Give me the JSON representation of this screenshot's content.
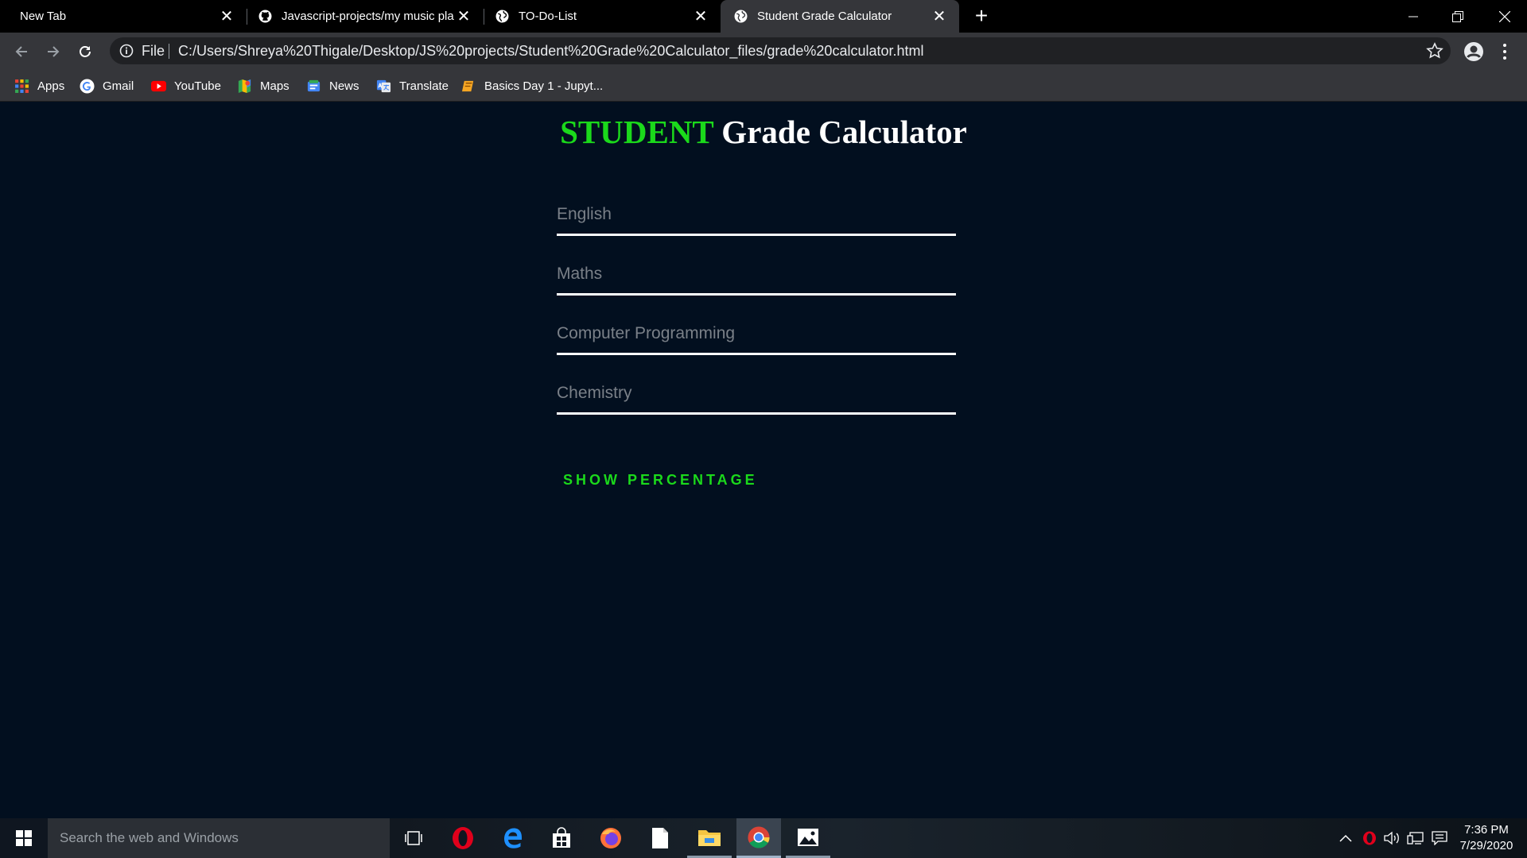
{
  "browser": {
    "tabs": [
      {
        "title": "New Tab",
        "active": false
      },
      {
        "title": "Javascript-projects/my music pla",
        "active": false
      },
      {
        "title": "TO-Do-List",
        "active": false
      },
      {
        "title": "Student Grade Calculator",
        "active": true
      }
    ],
    "address": {
      "scheme_label": "File",
      "url": "C:/Users/Shreya%20Thigale/Desktop/JS%20projects/Student%20Grade%20Calculator_files/grade%20calculator.html"
    },
    "bookmarks": [
      {
        "label": "Apps",
        "icon": "apps-grid-icon"
      },
      {
        "label": "Gmail",
        "icon": "google-icon"
      },
      {
        "label": "YouTube",
        "icon": "youtube-icon"
      },
      {
        "label": "Maps",
        "icon": "maps-icon"
      },
      {
        "label": "News",
        "icon": "news-icon"
      },
      {
        "label": "Translate",
        "icon": "translate-icon"
      },
      {
        "label": "Basics Day 1 - Jupyt...",
        "icon": "jupyter-icon"
      }
    ]
  },
  "page": {
    "title_accent": "STUDENT",
    "title_rest": " Grade Calculator",
    "fields": [
      {
        "placeholder": "English",
        "value": ""
      },
      {
        "placeholder": "Maths",
        "value": ""
      },
      {
        "placeholder": "Computer Programming",
        "value": ""
      },
      {
        "placeholder": "Chemistry",
        "value": ""
      }
    ],
    "button_label": "SHOW PERCENTAGE",
    "colors": {
      "background": "#020f1f",
      "accent": "#1bd91b",
      "text": "#ffffff"
    }
  },
  "taskbar": {
    "search_placeholder": "Search the web and Windows",
    "apps": [
      "task-view-icon",
      "opera-icon",
      "edge-icon",
      "store-icon",
      "firefox-icon",
      "file-icon",
      "file-explorer-icon",
      "chrome-icon",
      "photos-icon"
    ],
    "clock_time": "7:36 PM",
    "clock_date": "7/29/2020"
  }
}
